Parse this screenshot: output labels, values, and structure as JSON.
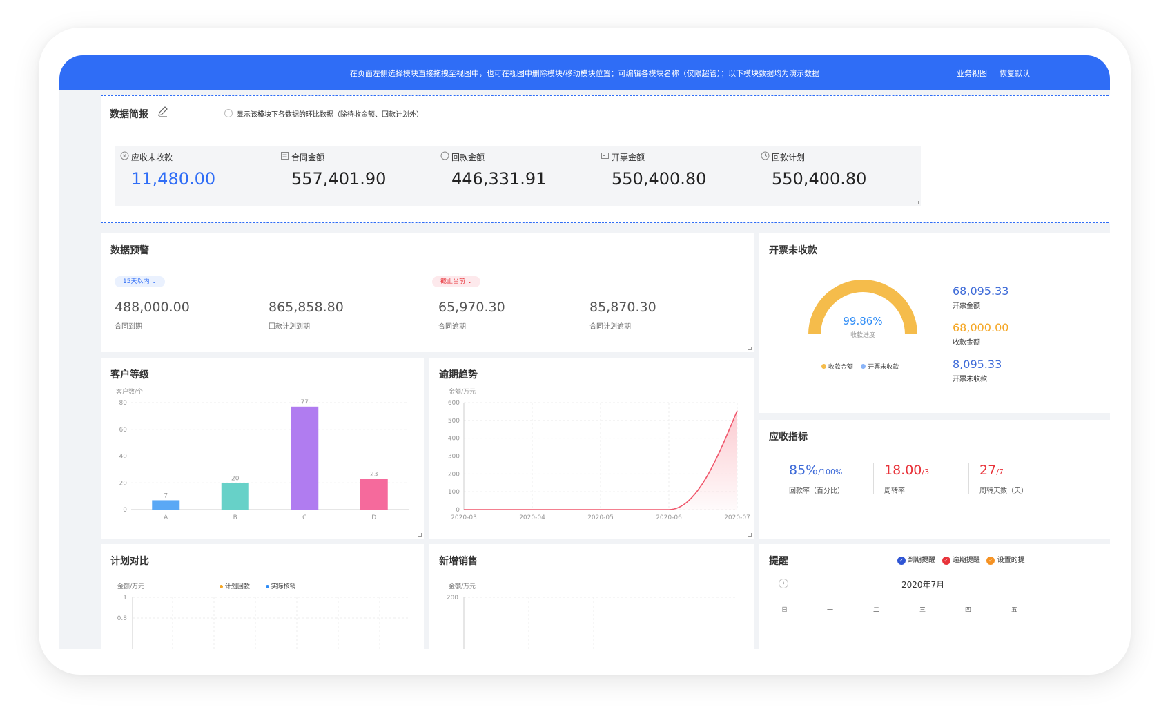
{
  "banner": {
    "message": "在页面左侧选择模块直接拖拽至视图中，也可在视图中删除模块/移动模块位置；可编辑各模块名称（仅限超管）；以下模块数据均为演示数据",
    "business_view": "业务视图",
    "restore_default": "恢复默认"
  },
  "summary": {
    "title": "数据简报",
    "toggle_label": "显示该模块下各数据的环比数据（除待收金额、回款计划外）",
    "stats": [
      {
        "label": "应收未收款",
        "value": "11,480.00",
        "icon": "coin-icon",
        "highlight": true
      },
      {
        "label": "合同金额",
        "value": "557,401.90",
        "icon": "contract-icon"
      },
      {
        "label": "回款金额",
        "value": "446,331.91",
        "icon": "payment-icon"
      },
      {
        "label": "开票金额",
        "value": "550,400.80",
        "icon": "invoice-icon"
      },
      {
        "label": "回款计划",
        "value": "550,400.80",
        "icon": "clock-icon"
      }
    ]
  },
  "alert": {
    "title": "数据预警",
    "filter1": "15天以内",
    "filter2": "截止当前",
    "items": [
      {
        "value": "488,000.00",
        "label": "合同到期"
      },
      {
        "value": "865,858.80",
        "label": "回款计划到期"
      },
      {
        "value": "65,970.30",
        "label": "合同逾期"
      },
      {
        "value": "85,870.30",
        "label": "合同计划逾期"
      }
    ]
  },
  "invoice_unpaid": {
    "title": "开票未收款",
    "progress_percent": 99.86,
    "progress_text": "99.86%",
    "progress_label": "收款进度",
    "legend": [
      "收款金额",
      "开票未收款"
    ],
    "items": [
      {
        "value": "68,095.33",
        "label": "开票金额",
        "color": "#3e6bd8"
      },
      {
        "value": "68,000.00",
        "label": "收款金额",
        "color": "#f5a623"
      },
      {
        "value": "8,095.33",
        "label": "开票未收款",
        "color": "#3e6bd8"
      }
    ],
    "colors": {
      "gauge": "#f5bc4b",
      "legend_blue": "#8ab4f8"
    }
  },
  "customer_level": {
    "title": "客户等级",
    "chart_data": {
      "type": "bar",
      "ylabel": "客户数/个",
      "categories": [
        "A",
        "B",
        "C",
        "D"
      ],
      "values": [
        7,
        20,
        77,
        23
      ],
      "colors": [
        "#5aa8f5",
        "#67d1c8",
        "#b07cf0",
        "#f56a9c"
      ],
      "ylim": [
        0,
        80
      ],
      "yticks": [
        0,
        20,
        40,
        60,
        80
      ]
    }
  },
  "overdue_trend": {
    "title": "逾期趋势",
    "chart_data": {
      "type": "area",
      "ylabel": "金额/万元",
      "x": [
        "2020-03",
        "2020-04",
        "2020-05",
        "2020-06",
        "2020-07"
      ],
      "values": [
        0,
        0,
        0,
        0,
        555
      ],
      "ylim": [
        0,
        600
      ],
      "yticks": [
        0,
        100,
        200,
        300,
        400,
        500,
        600
      ]
    }
  },
  "receivable": {
    "title": "应收指标",
    "items": [
      {
        "value": "85%",
        "suffix": "/100%",
        "label": "回款率（百分比）",
        "color": "#3e6bd8"
      },
      {
        "value": "18.00",
        "suffix": "/3",
        "label": "周转率",
        "color": "#e8333a"
      },
      {
        "value": "27",
        "suffix": "/7",
        "label": "周转天数（天）",
        "color": "#e8333a"
      }
    ]
  },
  "plan_compare": {
    "title": "计划对比",
    "ylabel": "金额/万元",
    "legend": [
      "计划回款",
      "实际核销"
    ],
    "yticks": [
      "1",
      "0.8"
    ]
  },
  "new_sales": {
    "title": "新增销售",
    "ylabel": "金额/万元",
    "yticks": [
      "200"
    ]
  },
  "reminder": {
    "title": "提醒",
    "legend": [
      "到期提醒",
      "逾期提醒",
      "设置的提"
    ],
    "month": "2020年7月",
    "weekdays": [
      "日",
      "一",
      "二",
      "三",
      "四",
      "五"
    ]
  }
}
